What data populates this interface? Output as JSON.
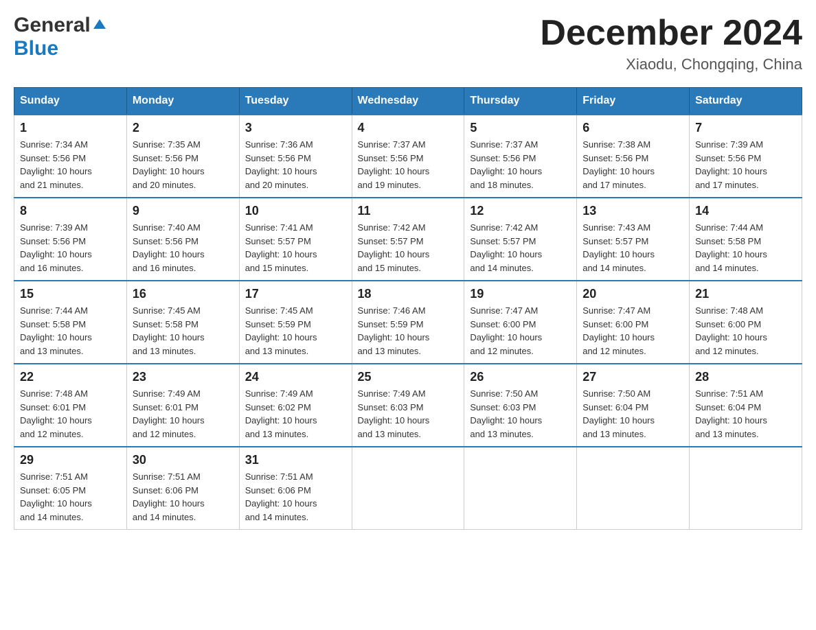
{
  "header": {
    "logo_general": "General",
    "logo_blue": "Blue",
    "month_title": "December 2024",
    "location": "Xiaodu, Chongqing, China"
  },
  "weekdays": [
    "Sunday",
    "Monday",
    "Tuesday",
    "Wednesday",
    "Thursday",
    "Friday",
    "Saturday"
  ],
  "weeks": [
    [
      {
        "day": "1",
        "sunrise": "7:34 AM",
        "sunset": "5:56 PM",
        "daylight": "10 hours and 21 minutes."
      },
      {
        "day": "2",
        "sunrise": "7:35 AM",
        "sunset": "5:56 PM",
        "daylight": "10 hours and 20 minutes."
      },
      {
        "day": "3",
        "sunrise": "7:36 AM",
        "sunset": "5:56 PM",
        "daylight": "10 hours and 20 minutes."
      },
      {
        "day": "4",
        "sunrise": "7:37 AM",
        "sunset": "5:56 PM",
        "daylight": "10 hours and 19 minutes."
      },
      {
        "day": "5",
        "sunrise": "7:37 AM",
        "sunset": "5:56 PM",
        "daylight": "10 hours and 18 minutes."
      },
      {
        "day": "6",
        "sunrise": "7:38 AM",
        "sunset": "5:56 PM",
        "daylight": "10 hours and 17 minutes."
      },
      {
        "day": "7",
        "sunrise": "7:39 AM",
        "sunset": "5:56 PM",
        "daylight": "10 hours and 17 minutes."
      }
    ],
    [
      {
        "day": "8",
        "sunrise": "7:39 AM",
        "sunset": "5:56 PM",
        "daylight": "10 hours and 16 minutes."
      },
      {
        "day": "9",
        "sunrise": "7:40 AM",
        "sunset": "5:56 PM",
        "daylight": "10 hours and 16 minutes."
      },
      {
        "day": "10",
        "sunrise": "7:41 AM",
        "sunset": "5:57 PM",
        "daylight": "10 hours and 15 minutes."
      },
      {
        "day": "11",
        "sunrise": "7:42 AM",
        "sunset": "5:57 PM",
        "daylight": "10 hours and 15 minutes."
      },
      {
        "day": "12",
        "sunrise": "7:42 AM",
        "sunset": "5:57 PM",
        "daylight": "10 hours and 14 minutes."
      },
      {
        "day": "13",
        "sunrise": "7:43 AM",
        "sunset": "5:57 PM",
        "daylight": "10 hours and 14 minutes."
      },
      {
        "day": "14",
        "sunrise": "7:44 AM",
        "sunset": "5:58 PM",
        "daylight": "10 hours and 14 minutes."
      }
    ],
    [
      {
        "day": "15",
        "sunrise": "7:44 AM",
        "sunset": "5:58 PM",
        "daylight": "10 hours and 13 minutes."
      },
      {
        "day": "16",
        "sunrise": "7:45 AM",
        "sunset": "5:58 PM",
        "daylight": "10 hours and 13 minutes."
      },
      {
        "day": "17",
        "sunrise": "7:45 AM",
        "sunset": "5:59 PM",
        "daylight": "10 hours and 13 minutes."
      },
      {
        "day": "18",
        "sunrise": "7:46 AM",
        "sunset": "5:59 PM",
        "daylight": "10 hours and 13 minutes."
      },
      {
        "day": "19",
        "sunrise": "7:47 AM",
        "sunset": "6:00 PM",
        "daylight": "10 hours and 12 minutes."
      },
      {
        "day": "20",
        "sunrise": "7:47 AM",
        "sunset": "6:00 PM",
        "daylight": "10 hours and 12 minutes."
      },
      {
        "day": "21",
        "sunrise": "7:48 AM",
        "sunset": "6:00 PM",
        "daylight": "10 hours and 12 minutes."
      }
    ],
    [
      {
        "day": "22",
        "sunrise": "7:48 AM",
        "sunset": "6:01 PM",
        "daylight": "10 hours and 12 minutes."
      },
      {
        "day": "23",
        "sunrise": "7:49 AM",
        "sunset": "6:01 PM",
        "daylight": "10 hours and 12 minutes."
      },
      {
        "day": "24",
        "sunrise": "7:49 AM",
        "sunset": "6:02 PM",
        "daylight": "10 hours and 13 minutes."
      },
      {
        "day": "25",
        "sunrise": "7:49 AM",
        "sunset": "6:03 PM",
        "daylight": "10 hours and 13 minutes."
      },
      {
        "day": "26",
        "sunrise": "7:50 AM",
        "sunset": "6:03 PM",
        "daylight": "10 hours and 13 minutes."
      },
      {
        "day": "27",
        "sunrise": "7:50 AM",
        "sunset": "6:04 PM",
        "daylight": "10 hours and 13 minutes."
      },
      {
        "day": "28",
        "sunrise": "7:51 AM",
        "sunset": "6:04 PM",
        "daylight": "10 hours and 13 minutes."
      }
    ],
    [
      {
        "day": "29",
        "sunrise": "7:51 AM",
        "sunset": "6:05 PM",
        "daylight": "10 hours and 14 minutes."
      },
      {
        "day": "30",
        "sunrise": "7:51 AM",
        "sunset": "6:06 PM",
        "daylight": "10 hours and 14 minutes."
      },
      {
        "day": "31",
        "sunrise": "7:51 AM",
        "sunset": "6:06 PM",
        "daylight": "10 hours and 14 minutes."
      },
      null,
      null,
      null,
      null
    ]
  ],
  "labels": {
    "sunrise": "Sunrise:",
    "sunset": "Sunset:",
    "daylight": "Daylight:"
  }
}
